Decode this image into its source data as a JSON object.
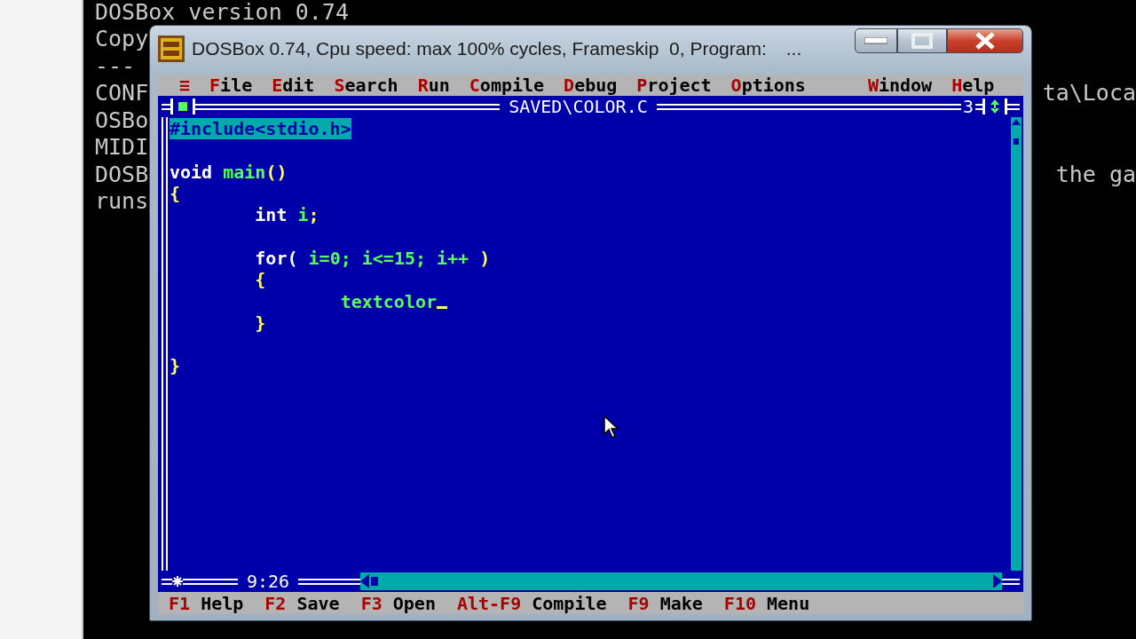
{
  "console": {
    "lines": [
      {
        "left": "DOSBox version 0.74"
      },
      {
        "left": "Copy"
      },
      {
        "left": "---"
      },
      {
        "left": "CONF",
        "right": "ta\\Loca"
      },
      {
        "left": "OSBo"
      },
      {
        "left": "MIDI"
      },
      {
        "left": "DOSB",
        "right": "the ga"
      },
      {
        "left": "runs"
      }
    ]
  },
  "window": {
    "title": "DOSBox 0.74, Cpu speed: max 100% cycles, Frameskip  0, Program:",
    "title_overflow": "..."
  },
  "menu": [
    {
      "hotkey": "≡"
    },
    {
      "hotkey": "F",
      "rest": "ile"
    },
    {
      "hotkey": "E",
      "rest": "dit"
    },
    {
      "hotkey": "S",
      "rest": "earch"
    },
    {
      "hotkey": "R",
      "rest": "un"
    },
    {
      "hotkey": "C",
      "rest": "ompile"
    },
    {
      "hotkey": "D",
      "rest": "ebug"
    },
    {
      "hotkey": "P",
      "rest": "roject"
    },
    {
      "hotkey": "O",
      "rest": "ptions"
    },
    {
      "hotkey": "W",
      "rest": "indow"
    },
    {
      "hotkey": "H",
      "rest": "elp"
    }
  ],
  "editor": {
    "file_name": "SAVED\\COLOR.C",
    "window_number": "3",
    "cursor_position": "9:26",
    "lines": [
      {
        "selected": true,
        "cursor": false,
        "segments": [
          {
            "kind": "preproc",
            "text": "#include<stdio.h>"
          }
        ]
      },
      {
        "selected": false,
        "cursor": false
      },
      {
        "selected": false,
        "cursor": false,
        "segments": [
          {
            "kind": "keyword",
            "text": "void "
          },
          {
            "kind": "ident",
            "text": "main"
          },
          {
            "kind": "punct",
            "text": "()"
          }
        ]
      },
      {
        "selected": false,
        "cursor": false,
        "segments": [
          {
            "kind": "punct",
            "text": "{"
          }
        ]
      },
      {
        "selected": false,
        "cursor": false,
        "segments": [
          {
            "kind": "keyword",
            "text": "        int "
          },
          {
            "kind": "ident",
            "text": "i"
          },
          {
            "kind": "punct",
            "text": ";"
          }
        ]
      },
      {
        "selected": false,
        "cursor": false
      },
      {
        "selected": false,
        "cursor": false,
        "segments": [
          {
            "kind": "keyword",
            "text": "        for( "
          },
          {
            "kind": "ident",
            "text": "i=0; i<=15; i++"
          },
          {
            "kind": "punct",
            "text": " )"
          }
        ]
      },
      {
        "selected": false,
        "cursor": false,
        "segments": [
          {
            "kind": "punct",
            "text": "        {"
          }
        ]
      },
      {
        "selected": false,
        "cursor": true,
        "segments": [
          {
            "kind": "ident",
            "text": "                textcolor"
          }
        ]
      },
      {
        "selected": false,
        "cursor": false,
        "segments": [
          {
            "kind": "punct",
            "text": "        }"
          }
        ]
      },
      {
        "selected": false,
        "cursor": false
      },
      {
        "selected": false,
        "cursor": false,
        "segments": [
          {
            "kind": "punct",
            "text": "}"
          }
        ]
      }
    ]
  },
  "status_bar": [
    {
      "key": "F1",
      "label": "Help"
    },
    {
      "key": "F2",
      "label": "Save"
    },
    {
      "key": "F3",
      "label": "Open"
    },
    {
      "key": "Alt-F9",
      "label": "Compile"
    },
    {
      "key": "F9",
      "label": "Make"
    },
    {
      "key": "F10",
      "label": "Menu"
    }
  ]
}
